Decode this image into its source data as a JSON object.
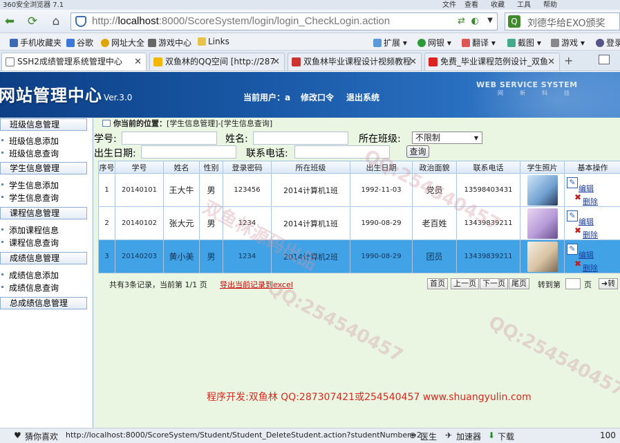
{
  "browser": {
    "title": "360安全浏览器 7.1",
    "menu": [
      "文件",
      "查看",
      "收藏",
      "工具",
      "帮助"
    ],
    "address_prefix": "http://",
    "address_host": "localhost",
    "address_rest": ":8000/ScoreSystem/login/login_CheckLogin.action",
    "search_text": "刘德华给EXO颁奖",
    "bookmarks": [
      "手机收藏夹",
      "谷歌",
      "网址大全",
      "游戏中心",
      "Links"
    ],
    "toolbar_right": [
      "扩展",
      "网银",
      "翻译",
      "截图",
      "游戏",
      "登录"
    ],
    "tabs": [
      {
        "label": "SSH2成绩管理系统管理中心"
      },
      {
        "label": "双鱼林的QQ空间 [http://287"
      },
      {
        "label": "双鱼林毕业课程设计视频教程"
      },
      {
        "label": "免费_毕业课程范例设计_双鱼"
      }
    ]
  },
  "header": {
    "title": "网站管理中心",
    "version": "Ver.3.0",
    "current_user_label": "当前用户：a",
    "change_pwd": "修改口令",
    "logout": "退出系统",
    "ws_title": "WEB SERVICE SYSTEM",
    "ws_sub": "网新科技"
  },
  "sidebar": {
    "groups": [
      {
        "title": "班级信息管理",
        "items": [
          "班级信息添加",
          "班级信息查询"
        ]
      },
      {
        "title": "学生信息管理",
        "items": [
          "学生信息添加",
          "学生信息查询"
        ]
      },
      {
        "title": "课程信息管理",
        "items": [
          "添加课程信息",
          "课程信息查询"
        ]
      },
      {
        "title": "成绩信息管理",
        "items": [
          "成绩信息添加",
          "成绩信息查询"
        ]
      },
      {
        "title": "总成绩信息管理",
        "items": []
      }
    ]
  },
  "breadcrumb": {
    "label": "你当前的位置：",
    "path": "[学生信息管理]-[学生信息查询]"
  },
  "filters": {
    "student_no_label": "学号:",
    "name_label": "姓名:",
    "class_label": "所在班级:",
    "class_value": "不限制",
    "birth_label": "出生日期:",
    "phone_label": "联系电话:",
    "query_button": "查询"
  },
  "table": {
    "headers": [
      "序号",
      "学号",
      "姓名",
      "性别",
      "登录密码",
      "所在班级",
      "出生日期",
      "政治面貌",
      "联系电话",
      "学生照片",
      "基本操作"
    ],
    "rows": [
      [
        "1",
        "20140101",
        "王大牛",
        "男",
        "123456",
        "2014计算机1班",
        "1992-11-03",
        "党员",
        "13598403431"
      ],
      [
        "2",
        "20140102",
        "张大元",
        "男",
        "1234",
        "2014计算机1班",
        "1990-08-29",
        "老百姓",
        "13439839211"
      ],
      [
        "3",
        "20140203",
        "黄小美",
        "男",
        "1234",
        "2014计算机2班",
        "1990-08-29",
        "团员",
        "13439839211"
      ]
    ],
    "edit_label": "编辑",
    "delete_label": "删除"
  },
  "pager": {
    "info": "共有3条记录，当前第 1/1 页",
    "export": "导出当前记录到excel",
    "first": "首页",
    "prev": "上一页",
    "next": "下一页",
    "last": "尾页",
    "goto_label": "转到第",
    "page_unit": "页",
    "go": "转"
  },
  "footer": "程序开发:双鱼林 QQ:287307421或254540457 www.shuangyulin.com",
  "status": {
    "fav": "猜你喜欢",
    "url": "http://localhost:8000/ScoreSystem/Student/Student_DeleteStudent.action?studentNumber=2",
    "doctor": "医生",
    "accel": "加速器",
    "download": "下载",
    "zoom": "100"
  },
  "colors": {
    "header_blue": "#1a5aa8",
    "selected_row": "#41a3e6",
    "content_bg": "#eaf6e2",
    "footer_red": "#d8291e"
  }
}
